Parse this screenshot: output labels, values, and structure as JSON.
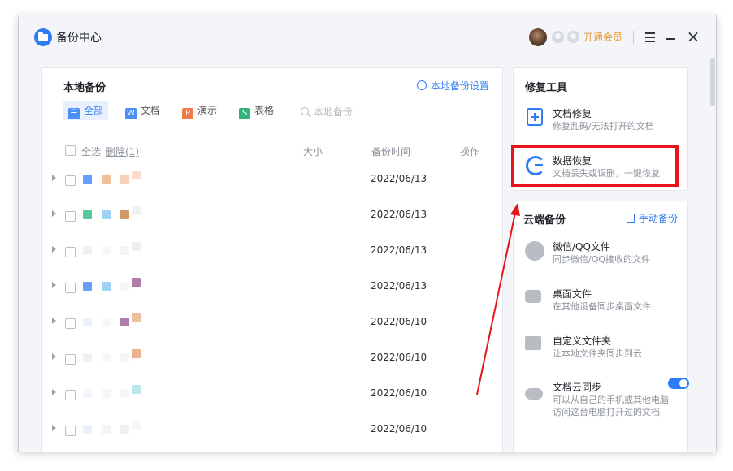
{
  "app": {
    "title": "备份中心",
    "vip_label": "开通会员"
  },
  "local": {
    "title": "本地备份",
    "settings_label": "本地备份设置",
    "filters": [
      {
        "label": "全部",
        "icon_char": "☰",
        "color": "#4a8ef8"
      },
      {
        "label": "文档",
        "icon_char": "W",
        "color": "#4a8ef8"
      },
      {
        "label": "演示",
        "icon_char": "P",
        "color": "#f07a4a"
      },
      {
        "label": "表格",
        "icon_char": "S",
        "color": "#33b27a"
      }
    ],
    "search_placeholder": "本地备份",
    "header": {
      "select_all": "全选",
      "delete": "删除(1)",
      "size": "大小",
      "time": "备份时间",
      "op": "操作"
    },
    "rows": [
      {
        "date": "2022/06/13",
        "swatches": [
          "#4a8ef8",
          "#f0b68a",
          "#f6c9a8",
          "#f8d6bf"
        ]
      },
      {
        "date": "2022/06/13",
        "swatches": [
          "#3cc08a",
          "#8fcaf5",
          "#c9864e",
          "#eeeeee"
        ]
      },
      {
        "date": "2022/06/13",
        "swatches": [
          "#eeeeee",
          "#f6f6f6",
          "#f2f2f2",
          "#ececec"
        ]
      },
      {
        "date": "2022/06/13",
        "swatches": [
          "#4a8ef8",
          "#8fcaf5",
          "#f4f4f4",
          "#a4659b"
        ]
      },
      {
        "date": "2022/06/10",
        "swatches": [
          "#e6eefc",
          "#f6f6f6",
          "#a4659b",
          "#eab68a"
        ]
      },
      {
        "date": "2022/06/10",
        "swatches": [
          "#eeeeee",
          "#f6f6f6",
          "#f4f4f4",
          "#e9a57a"
        ]
      },
      {
        "date": "2022/06/10",
        "swatches": [
          "#eef3fb",
          "#f6f6f6",
          "#f4f4f4",
          "#aee3e6"
        ]
      },
      {
        "date": "2022/06/10",
        "swatches": [
          "#e6eefc",
          "#f2f2f2",
          "#efefef",
          "#f6f6f6"
        ]
      }
    ]
  },
  "repair": {
    "title": "修复工具",
    "items": [
      {
        "title": "文档修复",
        "desc": "修复乱码/无法打开的文档"
      },
      {
        "title": "数据恢复",
        "desc": "文档丢失或误删，一键恢复"
      }
    ]
  },
  "cloud": {
    "title": "云端备份",
    "manual_label": "手动备份",
    "items": [
      {
        "title": "微信/QQ文件",
        "desc": "同步微信/QQ接收的文件"
      },
      {
        "title": "桌面文件",
        "desc": "在其他设备同步桌面文件"
      },
      {
        "title": "自定义文件夹",
        "desc": "让本地文件夹同步到云"
      },
      {
        "title": "文档云同步",
        "desc": "可以从自己的手机或其他电脑",
        "desc2": "访问这台电脑打开过的文档",
        "toggle_on": true
      }
    ]
  },
  "colors": {
    "accent": "#2f7df6",
    "highlight": "#e8141c",
    "vip": "#e8962a"
  }
}
